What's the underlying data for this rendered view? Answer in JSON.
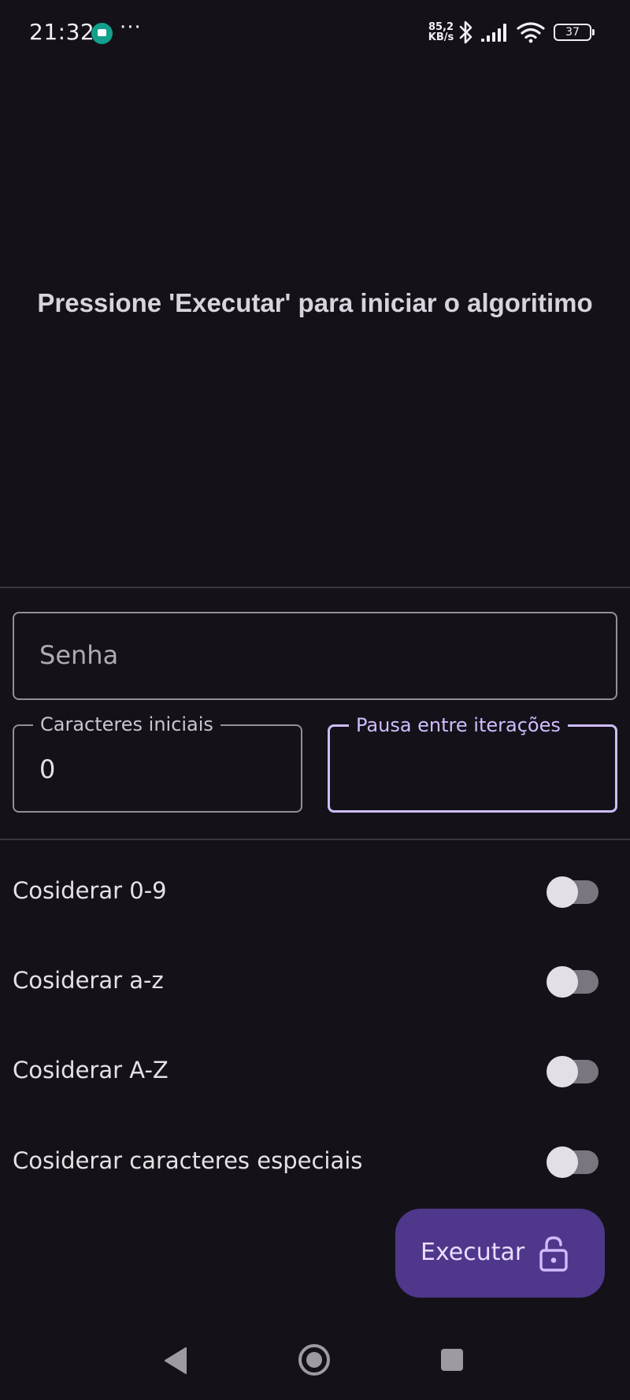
{
  "status_bar": {
    "time": "21:32",
    "more": "···",
    "net_speed_value": "85,2",
    "net_speed_unit": "KB/s",
    "battery": "37",
    "icons": [
      "app-notification-icon",
      "bluetooth-icon",
      "signal-icon",
      "wifi-icon",
      "battery-icon"
    ]
  },
  "prompt": {
    "text": "Pressione 'Executar' para iniciar o algoritimo"
  },
  "form": {
    "password": {
      "placeholder": "Senha",
      "value": ""
    },
    "initial_chars": {
      "label": "Caracteres iniciais",
      "value": "0"
    },
    "pause": {
      "label": "Pausa entre iterações",
      "value": ""
    }
  },
  "toggles": [
    {
      "label": "Cosiderar 0-9",
      "checked": false
    },
    {
      "label": "Cosiderar a-z",
      "checked": false
    },
    {
      "label": "Cosiderar A-Z",
      "checked": false
    },
    {
      "label": "Cosiderar caracteres especiais",
      "checked": false
    }
  ],
  "fab": {
    "label": "Executar",
    "icon": "lock-open-icon"
  },
  "nav": {
    "icons": [
      "back-icon",
      "home-icon",
      "recents-icon"
    ]
  },
  "colors": {
    "background": "#141218",
    "primary": "#D0BCFF",
    "fab_container": "#4F378B",
    "outline": "#938F99"
  }
}
